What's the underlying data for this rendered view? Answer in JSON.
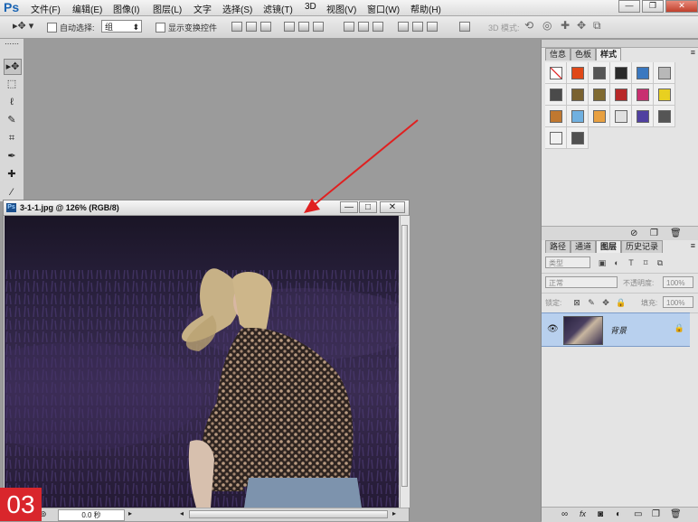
{
  "menubar": {
    "logo": "Ps",
    "items": [
      "文件(F)",
      "编辑(E)",
      "图像(I)",
      "图层(L)",
      "文字",
      "选择(S)",
      "滤镜(T)",
      "3D",
      "视图(V)",
      "窗口(W)",
      "帮助(H)"
    ],
    "win_minimize": "—",
    "win_restore": "❐",
    "win_close": "✕"
  },
  "options": {
    "auto_select_label": "自动选择:",
    "auto_select_value": "组",
    "show_transform_label": "显示变换控件",
    "mode_3d_label": "3D 模式:"
  },
  "document": {
    "title": "3-1-1.jpg @ 126% (RGB/8)",
    "btn_min": "—",
    "btn_max": "□",
    "btn_close": "✕",
    "status_zoom": "0.0 秒"
  },
  "panels": {
    "top_tabs": [
      "信息",
      "色板",
      "样式"
    ],
    "layer_tabs": [
      "路径",
      "通道",
      "图层",
      "历史记录"
    ],
    "kind_filter": "类型",
    "blend_mode": "正常",
    "opacity_label": "不透明度:",
    "opacity_value": "100%",
    "lock_label": "锁定:",
    "fill_label": "填充:",
    "fill_value": "100%",
    "layer_name": "背景"
  },
  "style_swatches": [
    "#ffffff",
    "#e04818",
    "#555555",
    "#2a2a2a",
    "#3a78c0",
    "#b8b8b8",
    "#4a4a4a",
    "#7a6230",
    "#806a30",
    "#b82828",
    "#c83070",
    "#e8d020",
    "#c07830",
    "#70b0e0",
    "#e8a040",
    "#e0e0e0",
    "#5040a0",
    "#555555",
    "#f0f0f0",
    "#505050"
  ],
  "badge": "03",
  "colors": {
    "accent_badge": "#d9262c",
    "selection": "#b8d0ee",
    "arrow": "#e02020"
  }
}
